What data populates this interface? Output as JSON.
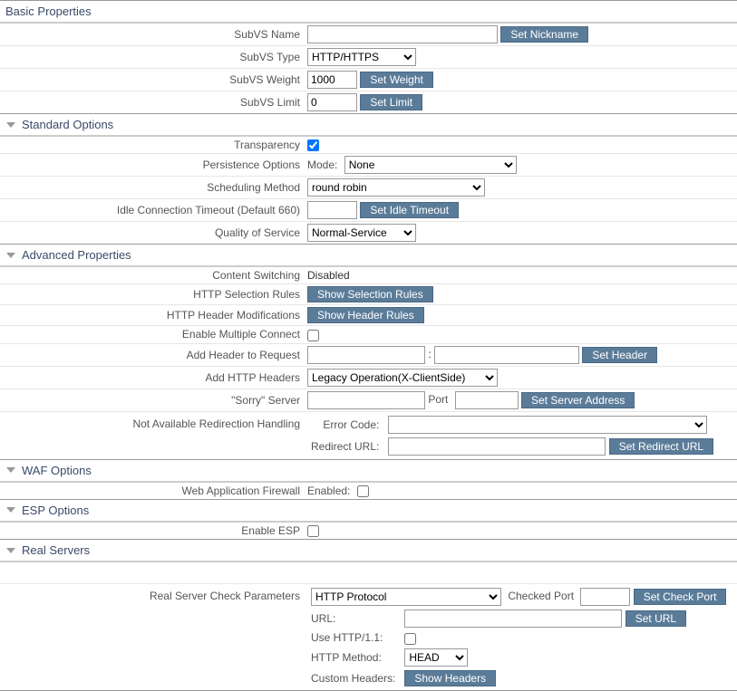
{
  "sections": {
    "basic": {
      "title": "Basic Properties",
      "rows": {
        "name_label": "SubVS Name",
        "name_value": "",
        "set_nickname": "Set Nickname",
        "type_label": "SubVS Type",
        "type_value": "HTTP/HTTPS",
        "weight_label": "SubVS Weight",
        "weight_value": "1000",
        "set_weight": "Set Weight",
        "limit_label": "SubVS Limit",
        "limit_value": "0",
        "set_limit": "Set Limit"
      }
    },
    "standard": {
      "title": "Standard Options",
      "transparency_label": "Transparency",
      "persistence_label": "Persistence Options",
      "persistence_mode_label": "Mode:",
      "persistence_mode_value": "None",
      "scheduling_label": "Scheduling Method",
      "scheduling_value": "round robin",
      "idle_label": "Idle Connection Timeout (Default 660)",
      "idle_value": "",
      "set_idle": "Set Idle Timeout",
      "qos_label": "Quality of Service",
      "qos_value": "Normal-Service"
    },
    "advanced": {
      "title": "Advanced Properties",
      "content_switching_label": "Content Switching",
      "content_switching_value": "Disabled",
      "selection_label": "HTTP Selection Rules",
      "selection_btn": "Show Selection Rules",
      "header_mod_label": "HTTP Header Modifications",
      "header_mod_btn": "Show Header Rules",
      "multiple_connect_label": "Enable Multiple Connect",
      "add_header_label": "Add Header to Request",
      "set_header_btn": "Set Header",
      "add_http_headers_label": "Add HTTP Headers",
      "add_http_headers_value": "Legacy Operation(X-ClientSide)",
      "sorry_label": "\"Sorry\" Server",
      "port_label": "Port",
      "set_server_btn": "Set Server Address",
      "not_available_label": "Not Available Redirection Handling",
      "error_code_label": "Error Code:",
      "error_code_value": "",
      "redirect_url_label": "Redirect URL:",
      "redirect_url_value": "",
      "set_redirect_btn": "Set Redirect URL"
    },
    "waf": {
      "title": "WAF Options",
      "firewall_label": "Web Application Firewall",
      "enabled_label": "Enabled:"
    },
    "esp": {
      "title": "ESP Options",
      "enable_esp_label": "Enable ESP"
    },
    "real_servers": {
      "title": "Real Servers",
      "check_params_label": "Real Server Check Parameters",
      "check_params_value": "HTTP Protocol",
      "checked_port_label": "Checked Port",
      "checked_port_value": "",
      "set_check_port_btn": "Set Check Port",
      "url_label": "URL:",
      "url_value": "",
      "set_url_btn": "Set URL",
      "http11_label": "Use HTTP/1.1:",
      "http_method_label": "HTTP Method:",
      "http_method_value": "HEAD",
      "custom_headers_label": "Custom Headers:",
      "show_headers_btn": "Show Headers"
    }
  }
}
